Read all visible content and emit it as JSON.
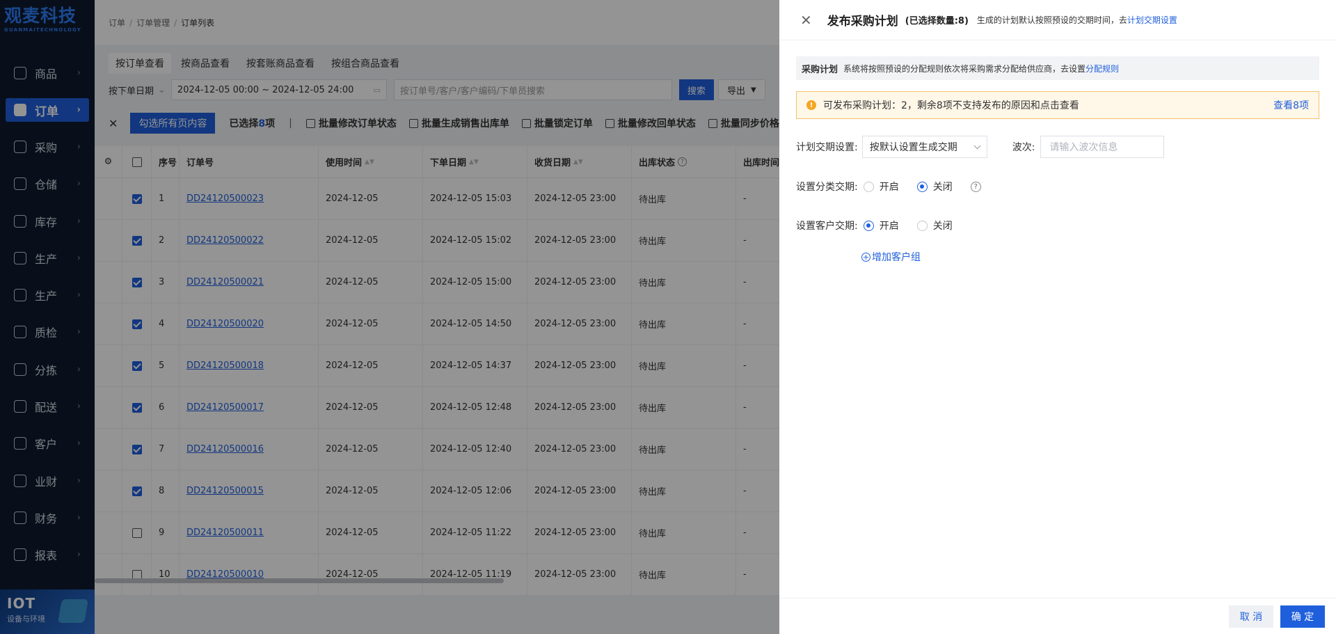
{
  "brand": {
    "name": "观麦科技",
    "sub": "GUANMAITECHNOLOGY"
  },
  "sidebar": {
    "items": [
      {
        "label": "商品",
        "icon": "goods-icon"
      },
      {
        "label": "订单",
        "icon": "order-icon",
        "active": true
      },
      {
        "label": "采购",
        "icon": "purchase-icon"
      },
      {
        "label": "仓储",
        "icon": "warehouse-icon"
      },
      {
        "label": "库存",
        "icon": "inventory-icon"
      },
      {
        "label": "生产",
        "icon": "production-icon"
      },
      {
        "label": "生产",
        "icon": "production-icon"
      },
      {
        "label": "质检",
        "icon": "quality-icon"
      },
      {
        "label": "分拣",
        "icon": "sorting-icon"
      },
      {
        "label": "配送",
        "icon": "delivery-icon"
      },
      {
        "label": "客户",
        "icon": "customer-icon"
      },
      {
        "label": "业财",
        "icon": "business-finance-icon"
      },
      {
        "label": "财务",
        "icon": "finance-icon"
      },
      {
        "label": "报表",
        "icon": "report-icon"
      }
    ],
    "iot": {
      "title": "IOT",
      "sub": "设备与环境"
    }
  },
  "breadcrumb": [
    "订单",
    "订单管理",
    "订单列表"
  ],
  "view_tabs": [
    "按订单查看",
    "按商品查看",
    "按套账商品查看",
    "按组合商品查看"
  ],
  "filters": {
    "date_type": "按下单日期",
    "date_range": "2024-12-05 00:00 ~ 2024-12-05 24:00",
    "search_placeholder": "按订单号/客户/客户编码/下单员搜索",
    "search_button": "搜索",
    "export_button": "导出"
  },
  "actions": {
    "select_all": "勾选所有页内容",
    "selected_prefix": "已选择",
    "selected_num": "8",
    "selected_suffix": "项",
    "separator": "|",
    "bulk": [
      "批量修改订单状态",
      "批量生成销售出库单",
      "批量锁定订单",
      "批量修改回单状态",
      "批量同步价格"
    ]
  },
  "table": {
    "headers": {
      "no": "序号",
      "order": "订单号",
      "use_time": "使用时间",
      "order_date": "下单日期",
      "receive_date": "收货日期",
      "out_status": "出库状态",
      "out_time": "出库时间"
    },
    "rows": [
      {
        "checked": true,
        "no": "1",
        "order": "DD24120500023",
        "use": "2024-12-05",
        "down": "2024-12-05 15:03",
        "recv": "2024-12-05 23:00",
        "status": "待出库",
        "out": "-"
      },
      {
        "checked": true,
        "no": "2",
        "order": "DD24120500022",
        "use": "2024-12-05",
        "down": "2024-12-05 15:02",
        "recv": "2024-12-05 23:00",
        "status": "待出库",
        "out": "-"
      },
      {
        "checked": true,
        "no": "3",
        "order": "DD24120500021",
        "use": "2024-12-05",
        "down": "2024-12-05 15:00",
        "recv": "2024-12-05 23:00",
        "status": "待出库",
        "out": "-"
      },
      {
        "checked": true,
        "no": "4",
        "order": "DD24120500020",
        "use": "2024-12-05",
        "down": "2024-12-05 14:50",
        "recv": "2024-12-05 23:00",
        "status": "待出库",
        "out": "-"
      },
      {
        "checked": true,
        "no": "5",
        "order": "DD24120500018",
        "use": "2024-12-05",
        "down": "2024-12-05 14:37",
        "recv": "2024-12-05 23:00",
        "status": "待出库",
        "out": "-"
      },
      {
        "checked": true,
        "no": "6",
        "order": "DD24120500017",
        "use": "2024-12-05",
        "down": "2024-12-05 12:48",
        "recv": "2024-12-05 23:00",
        "status": "待出库",
        "out": "-"
      },
      {
        "checked": true,
        "no": "7",
        "order": "DD24120500016",
        "use": "2024-12-05",
        "down": "2024-12-05 12:40",
        "recv": "2024-12-05 23:00",
        "status": "待出库",
        "out": "-"
      },
      {
        "checked": true,
        "no": "8",
        "order": "DD24120500015",
        "use": "2024-12-05",
        "down": "2024-12-05 12:06",
        "recv": "2024-12-05 23:00",
        "status": "待出库",
        "out": "-"
      },
      {
        "checked": false,
        "no": "9",
        "order": "DD24120500011",
        "use": "2024-12-05",
        "down": "2024-12-05 11:22",
        "recv": "2024-12-05 23:00",
        "status": "待出库",
        "out": "-"
      },
      {
        "checked": false,
        "no": "10",
        "order": "DD24120500010",
        "use": "2024-12-05",
        "down": "2024-12-05 11:19",
        "recv": "2024-12-05 23:00",
        "status": "待出库",
        "out": "-"
      }
    ]
  },
  "drawer": {
    "title": "发布采购计划",
    "count": "(已选择数量:8)",
    "note": "生成的计划默认按照预设的交期时间，去",
    "note_link": "计划交期设置",
    "section_title": "采购计划",
    "section_desc": "系统将按照预设的分配规则依次将采购需求分配给供应商，去设置",
    "section_link": "分配规则",
    "warning": "可发布采购计划：2，剩余8项不支持发布的原因和点击查看",
    "warning_link": "查看8项",
    "delivery_label": "计划交期设置:",
    "delivery_value": "按默认设置生成交期",
    "batch_label": "波次:",
    "batch_placeholder": "请输入波次信息",
    "category_label": "设置分类交期:",
    "customer_label": "设置客户交期:",
    "on": "开启",
    "off": "关闭",
    "category_on": false,
    "customer_on": true,
    "add_group": "增加客户组",
    "cancel": "取 消",
    "confirm": "确 定"
  },
  "colors": {
    "primary": "#1f5fdc",
    "sidebar_bg": "#0f1b2e",
    "warning_bg": "#fff7e8"
  }
}
